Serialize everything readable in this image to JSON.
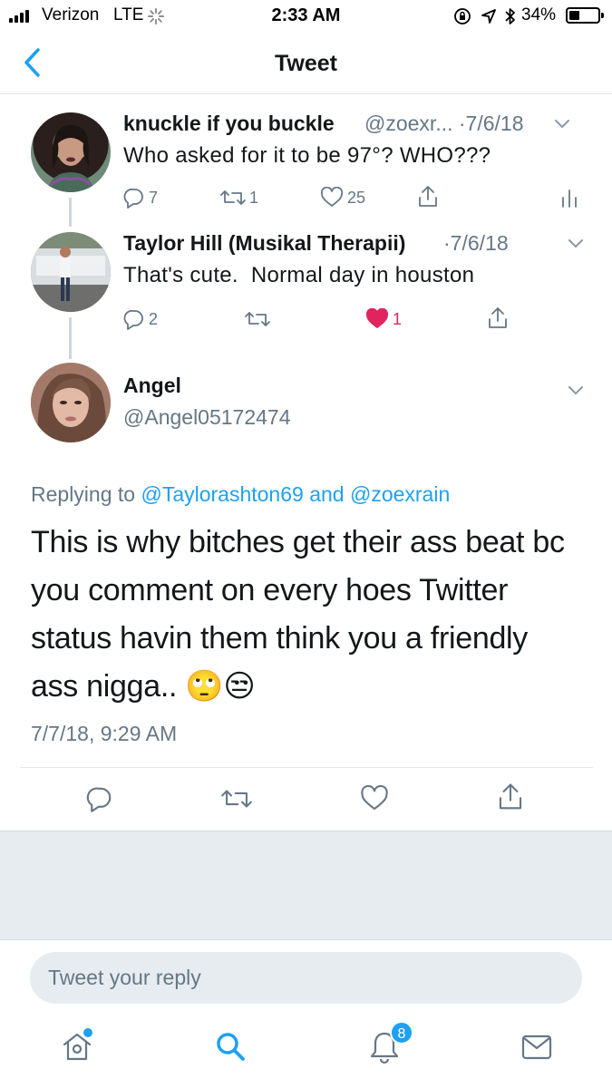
{
  "status_bar": {
    "carrier": "Verizon",
    "network": "LTE",
    "time": "2:33 AM",
    "battery": "34%"
  },
  "header": {
    "title": "Tweet"
  },
  "thread": [
    {
      "name": "knuckle if you buckle",
      "handle_date": "@zoexr... ·7/6/18",
      "text": "Who asked for it to be 97°? WHO???",
      "replies": "7",
      "retweets": "1",
      "likes": "25"
    },
    {
      "name": "Taylor Hill (Musikal Therapii)",
      "date": "·7/6/18",
      "text": "That's cute.  Normal day in houston",
      "replies": "2",
      "likes": "1"
    }
  ],
  "main_tweet": {
    "name": "Angel",
    "handle": "@Angel05172474",
    "replying_label": "Replying to",
    "reply_user_1": "@Taylorashton69",
    "reply_and": "and",
    "reply_user_2": "@zoexrain",
    "line1": "This is why bitches get their ass beat bc",
    "line2": "you comment on every hoes Twitter",
    "line3": "status havin them think you a friendly",
    "line4": "ass nigga.. 🙄😒",
    "timestamp": "7/7/18, 9:29 AM"
  },
  "reply_box": {
    "placeholder": "Tweet your reply"
  },
  "tab_bar": {
    "notifications_badge": "8"
  },
  "colors": {
    "accent": "#1da1f2",
    "like": "#e0245e",
    "muted": "#657786"
  }
}
